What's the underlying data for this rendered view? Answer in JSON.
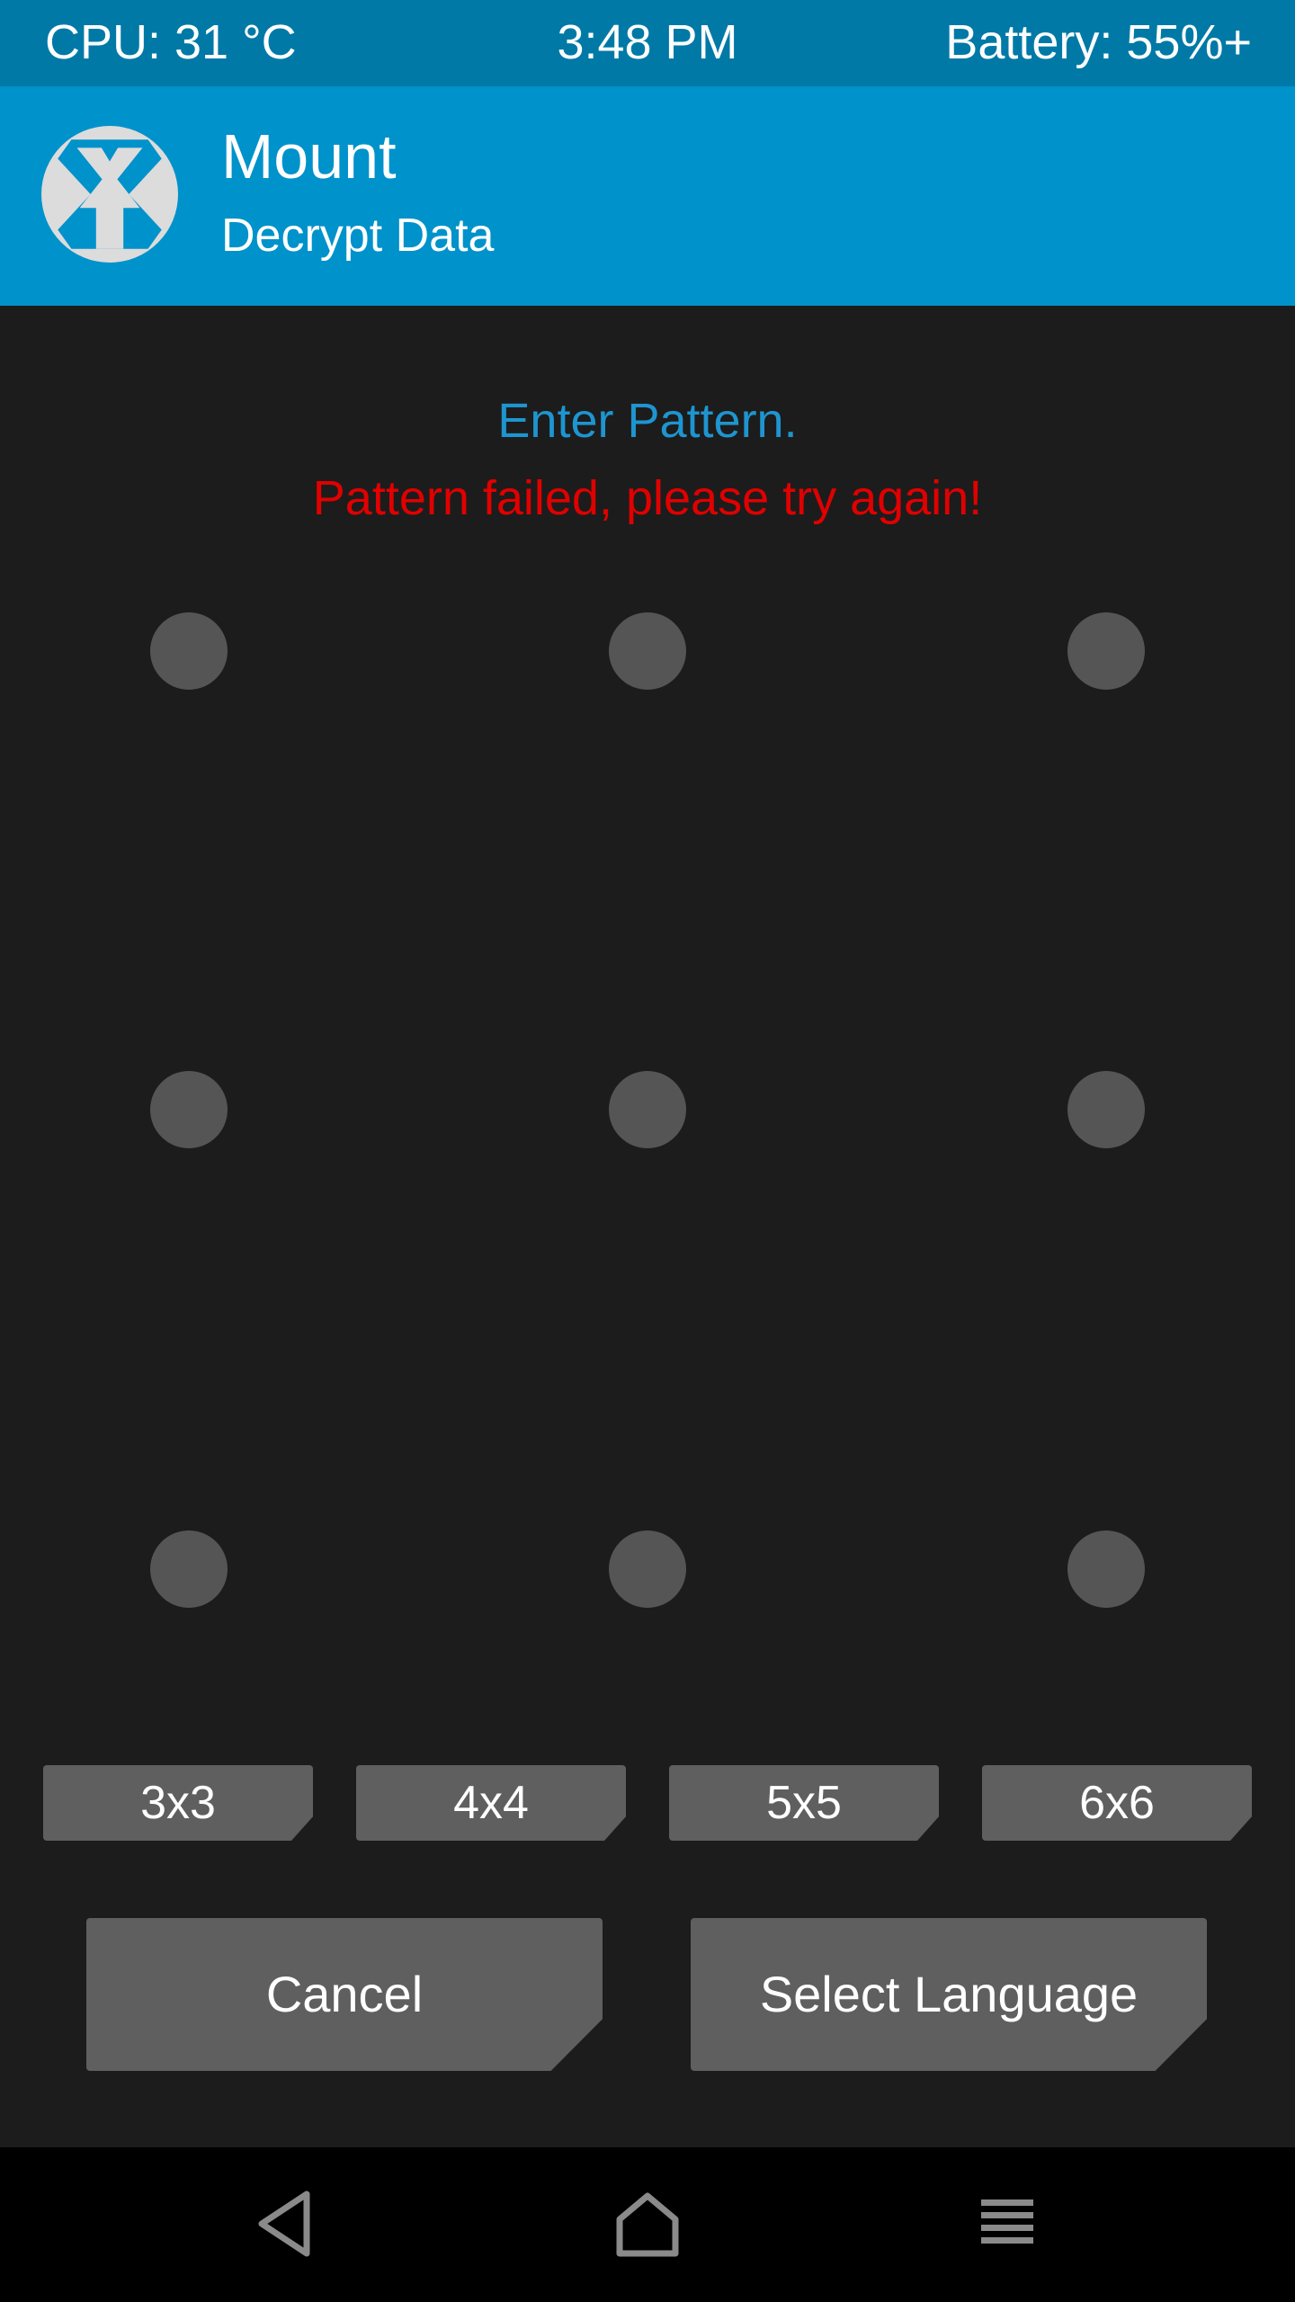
{
  "status_bar": {
    "cpu": "CPU: 31 °C",
    "time": "3:48 PM",
    "battery": "Battery: 55%+"
  },
  "header": {
    "logo_icon": "twrp-logo-icon",
    "title": "Mount",
    "subtitle": "Decrypt Data"
  },
  "messages": {
    "prompt": "Enter Pattern.",
    "error": "Pattern failed, please try again!"
  },
  "pattern": {
    "grid_size": "3x3",
    "dot_count": 9
  },
  "grid_sizes": [
    "3x3",
    "4x4",
    "5x5",
    "6x6"
  ],
  "actions": {
    "cancel": "Cancel",
    "select_language": "Select Language"
  },
  "nav_bar": {
    "icons": [
      "back-icon",
      "home-icon",
      "menu-icon"
    ]
  },
  "colors": {
    "status_bar": "#0079a6",
    "header": "#0092ca",
    "background": "#1c1c1c",
    "prompt_text": "#1e95d0",
    "error_text": "#e00000",
    "button": "#5f5f5f",
    "dot": "#555555",
    "nav_bar": "#000000"
  }
}
